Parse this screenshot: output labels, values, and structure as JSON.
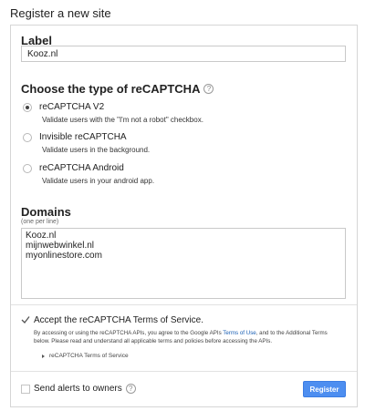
{
  "page": {
    "title": "Register a new site"
  },
  "label_section": {
    "heading": "Label",
    "input_value": "Kooz.nl"
  },
  "type_section": {
    "heading": "Choose the type of reCAPTCHA",
    "help_icon": "question-mark",
    "options": [
      {
        "title": "reCAPTCHA V2",
        "description": "Validate users with the \"I'm not a robot\" checkbox.",
        "selected": true
      },
      {
        "title": "Invisible reCAPTCHA",
        "description": "Validate users in the background.",
        "selected": false
      },
      {
        "title": "reCAPTCHA Android",
        "description": "Validate users in your android app.",
        "selected": false
      }
    ]
  },
  "domains_section": {
    "heading": "Domains",
    "subheading": "(one per line)",
    "value": "Kooz.nl\nmijnwebwinkel.nl\nmyonlinestore.com"
  },
  "terms": {
    "checkbox_label": "Accept the reCAPTCHA Terms of Service.",
    "checked": true,
    "text_before_link": "By accessing or using the reCAPTCHA APIs, you agree to the Google APIs ",
    "link_text": "Terms of Use",
    "text_after_link": ", and to the Additional Terms below. Please read and understand all applicable terms and policies before accessing the APIs.",
    "expander_label": "reCAPTCHA Terms of Service"
  },
  "footer": {
    "alerts_label": "Send alerts to owners",
    "alerts_checked": false,
    "register_label": "Register"
  },
  "colors": {
    "accent": "#4d8ef0",
    "link": "#1a5fb4",
    "border": "#d6d6d6"
  }
}
